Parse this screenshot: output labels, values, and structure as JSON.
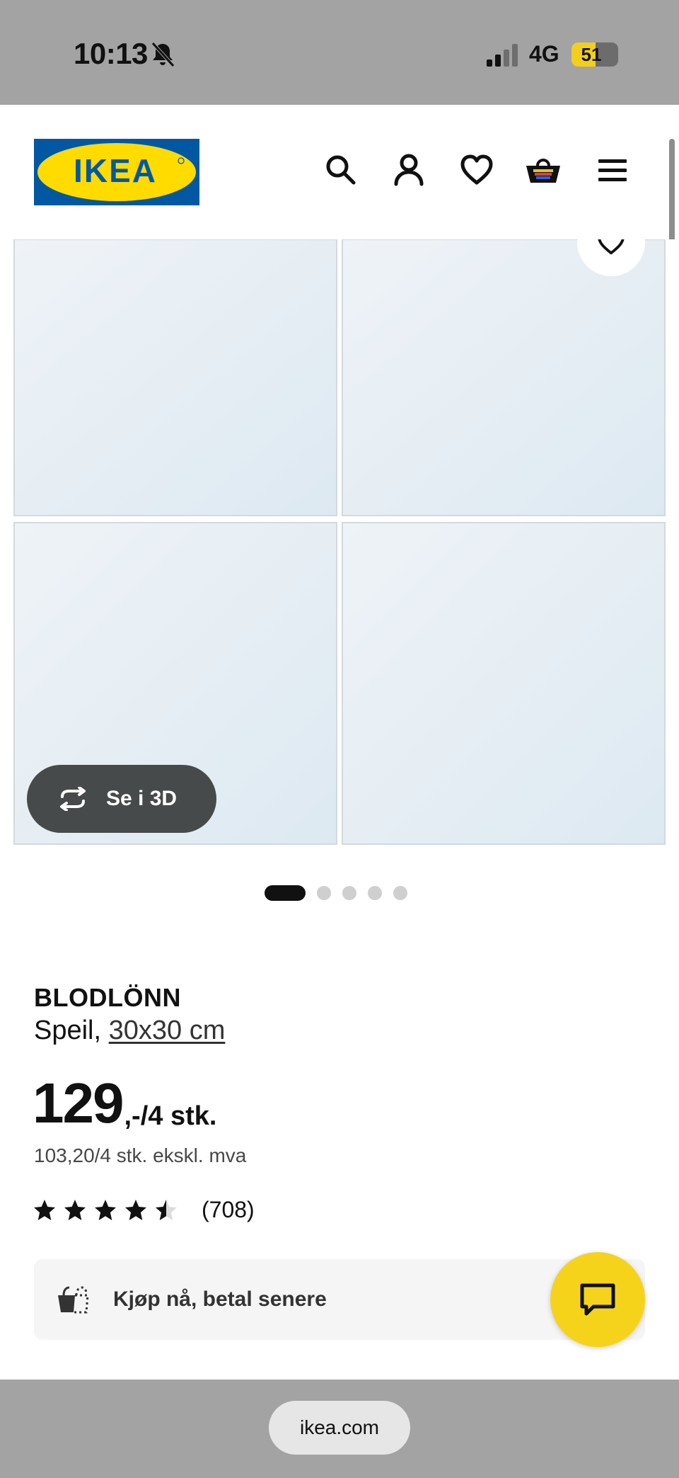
{
  "status_bar": {
    "time": "10:13",
    "network": "4G",
    "battery": "51"
  },
  "header": {
    "logo_text": "IKEA",
    "icons": [
      "search-icon",
      "account-icon",
      "heart-icon",
      "basket-icon",
      "menu-icon"
    ]
  },
  "gallery": {
    "view3d_label": "Se i 3D",
    "page_count": 5,
    "active_page": 1
  },
  "product": {
    "name": "BLODLÖNN",
    "type_prefix": "Speil, ",
    "size": "30x30 cm",
    "price_main": "129",
    "price_suffix": ",-/4 stk.",
    "price_excl_vat": "103,20/4 stk. ekskl. mva",
    "rating": 4.5,
    "rating_max": 5,
    "review_count": "(708)"
  },
  "pay_later": {
    "label": "Kjøp nå, betal senere"
  },
  "browser": {
    "url": "ikea.com"
  },
  "colors": {
    "ikea_blue": "#0058a3",
    "ikea_yellow": "#ffdb00",
    "chat_yellow": "#f6d31b",
    "status_gray": "#a3a3a3",
    "mirror_tint": "#e4eef5"
  }
}
